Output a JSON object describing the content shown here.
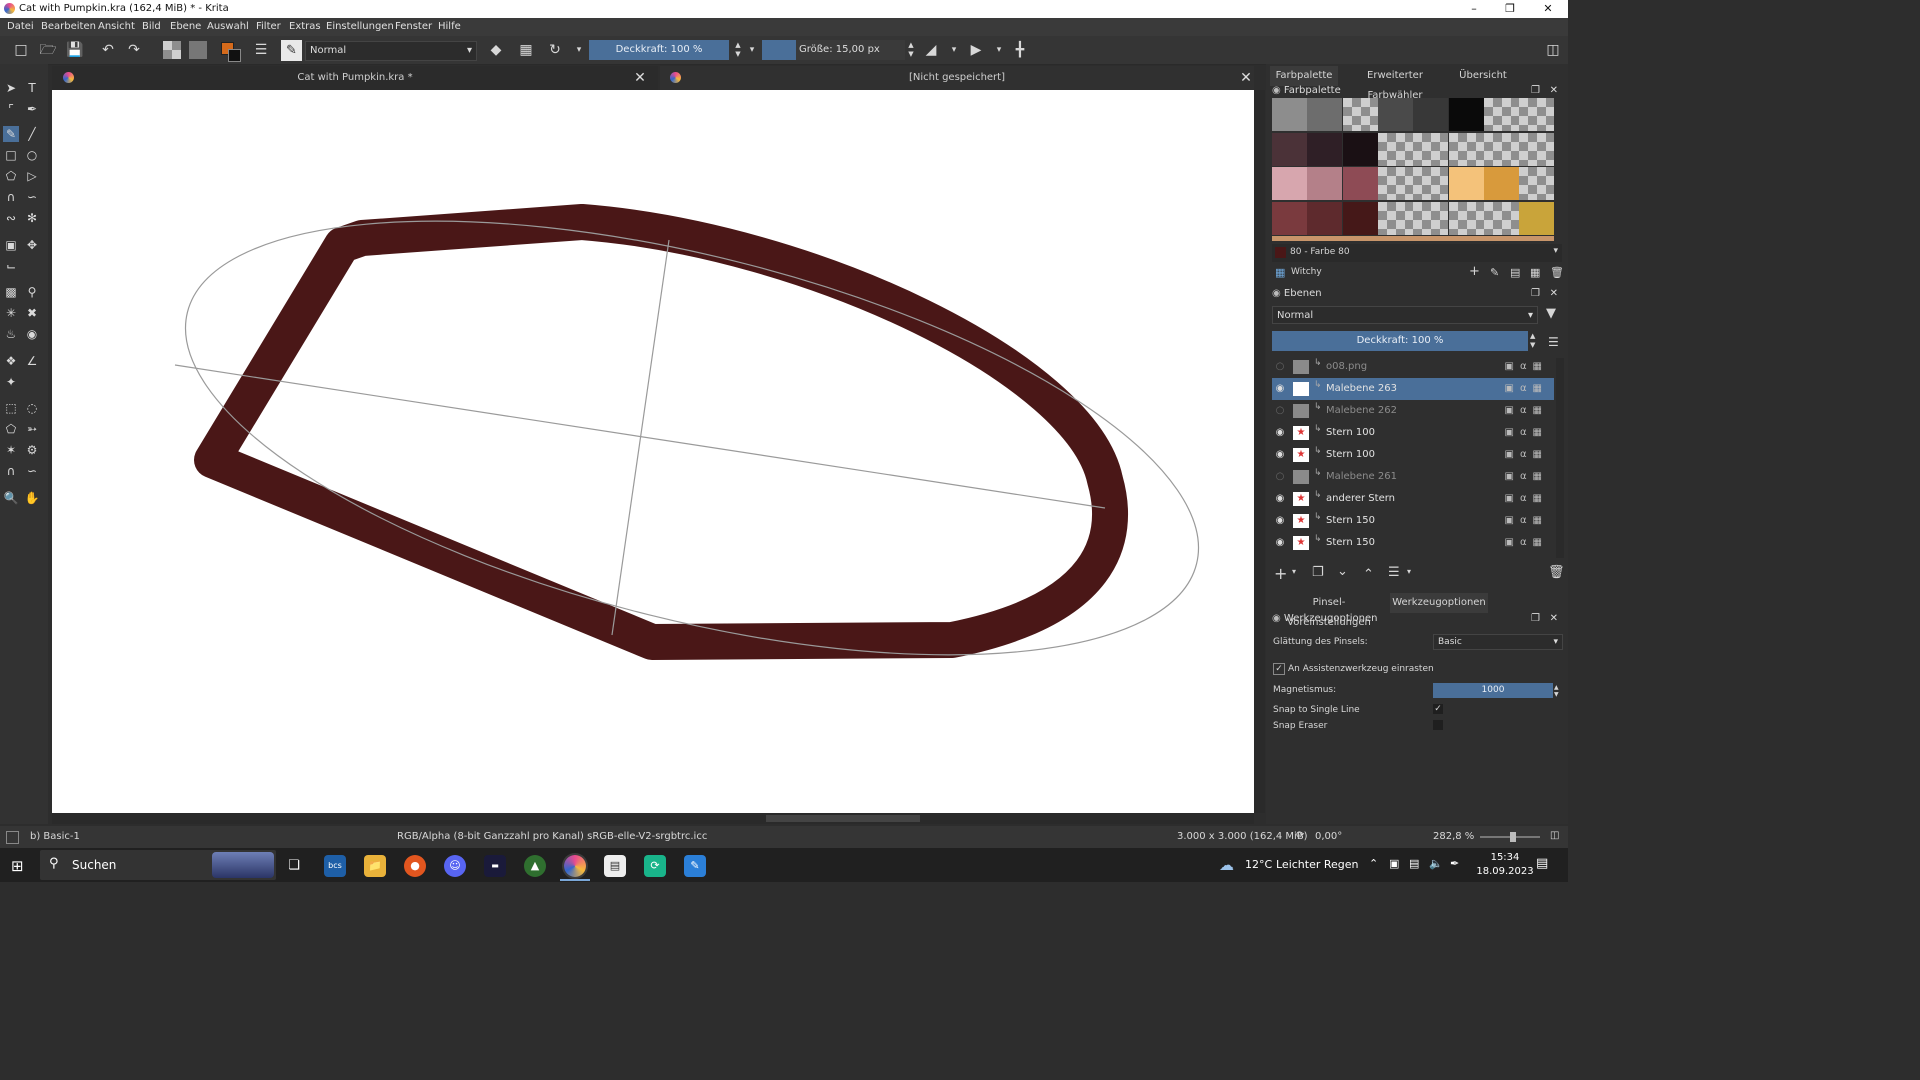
{
  "window": {
    "title": "Cat with Pumpkin.kra (162,4 MiB)  * - Krita"
  },
  "menu": [
    "Datei",
    "Bearbeiten",
    "Ansicht",
    "Bild",
    "Ebene",
    "Auswahl",
    "Filter",
    "Extras",
    "Einstellungen",
    "Fenster",
    "Hilfe"
  ],
  "toolbar": {
    "blend_mode": "Normal",
    "opacity_label": "Deckkraft: 100 %",
    "size_label": "Größe: 15,00 px"
  },
  "canvas_tabs": [
    {
      "label": "Cat with Pumpkin.kra *"
    },
    {
      "label": "[Nicht gespeichert]"
    }
  ],
  "dock": {
    "top_tabs": [
      "Farbpalette",
      "Erweiterter Farbwähler",
      "Übersicht"
    ],
    "palette": {
      "title": "Farbpalette",
      "selected_color": "80 - Farbe 80",
      "palette_name": "Witchy",
      "swatches": [
        "#8d8d8d",
        "#6d6d6d",
        "checker",
        "#4a4a4a",
        "#383838",
        "#0a0a0a",
        "checker",
        "checker",
        "#4b3238",
        "#2f1f26",
        "#1a1014",
        "checker",
        "checker",
        "checker",
        "checker",
        "checker",
        "#d7a6ae",
        "#b48089",
        "#8e4b55",
        "checker",
        "checker",
        "#f4c27a",
        "#d89a3c",
        "checker",
        "#7a3a3e",
        "#5e2a2d",
        "#451818",
        "checker",
        "checker",
        "checker",
        "checker",
        "#c9a43a"
      ]
    },
    "layers": {
      "title": "Ebenen",
      "blend_mode": "Normal",
      "opacity_label": "Deckkraft:  100 %",
      "items": [
        {
          "name": "o08.png",
          "visible": false
        },
        {
          "name": "Malebene 263",
          "visible": true,
          "selected": true
        },
        {
          "name": "Malebene 262",
          "visible": false
        },
        {
          "name": "Stern 100",
          "visible": true
        },
        {
          "name": "Stern 100",
          "visible": true
        },
        {
          "name": "Malebene 261",
          "visible": false
        },
        {
          "name": "anderer Stern",
          "visible": true
        },
        {
          "name": "Stern 150",
          "visible": true
        },
        {
          "name": "Stern 150",
          "visible": true
        }
      ]
    },
    "lower_tabs": [
      "Pinsel-Voreinstellungen",
      "Werkzeugoptionen"
    ],
    "tool_options": {
      "title": "Werkzeugoptionen",
      "smoothing_label": "Glättung des Pinsels:",
      "smoothing_value": "Basic",
      "snap_assistant_label": "An Assistenzwerkzeug einrasten",
      "magnetism_label": "Magnetismus:",
      "magnetism_value": "1000",
      "snap_single_line_label": "Snap to Single Line",
      "snap_eraser_label": "Snap Eraser"
    }
  },
  "status": {
    "brush": "b) Basic-1",
    "color_profile": "RGB/Alpha (8-bit Ganzzahl pro Kanal)  sRGB-elle-V2-srgbtrc.icc",
    "image_size": "3.000 x 3.000 (162,4 MiB)",
    "rotation": "0,00°",
    "zoom": "282,8 %"
  },
  "taskbar": {
    "search": "Suchen",
    "weather_temp": "12°C",
    "weather_text": "Leichter Regen",
    "time": "15:34",
    "date": "18.09.2023"
  },
  "colors": {
    "stroke": "#4a1717",
    "accent": "#4a6f99",
    "selected_layer": "#4a6f99"
  }
}
